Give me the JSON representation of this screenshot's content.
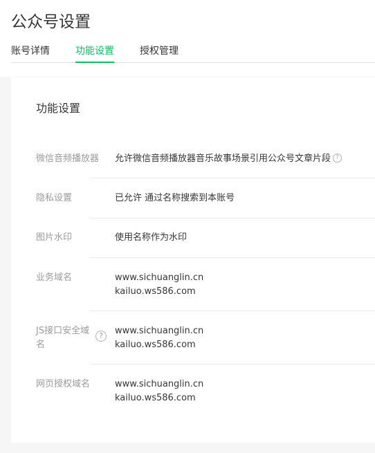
{
  "page": {
    "title": "公众号设置"
  },
  "tabs": [
    {
      "label": "账号详情",
      "active": false
    },
    {
      "label": "功能设置",
      "active": true
    },
    {
      "label": "授权管理",
      "active": false
    }
  ],
  "section": {
    "title": "功能设置"
  },
  "settings": {
    "wechat_player": {
      "label": "微信音频播放器",
      "value": "允许微信音频播放器音乐故事场景引用公众号文章片段",
      "help_icon": "question-circle-icon"
    },
    "privacy": {
      "label": "隐私设置",
      "value": "已允许 通过名称搜索到本账号"
    },
    "watermark": {
      "label": "图片水印",
      "value": "使用名称作为水印"
    },
    "business_domain": {
      "label": "业务域名",
      "values": [
        "www.sichuanglin.cn",
        "kailuo.ws586.com"
      ]
    },
    "js_domain": {
      "label": "JS接口安全域名",
      "values": [
        "www.sichuanglin.cn",
        "kailuo.ws586.com"
      ],
      "help_icon": "question-circle-icon"
    },
    "oauth_domain": {
      "label": "网页授权域名",
      "values": [
        "www.sichuanglin.cn",
        "kailuo.ws586.com"
      ]
    }
  },
  "colors": {
    "accent": "#07c160",
    "label": "#9a9a9a",
    "text": "#353535",
    "divider": "#eaeaea",
    "background": "#f6f6f6"
  }
}
